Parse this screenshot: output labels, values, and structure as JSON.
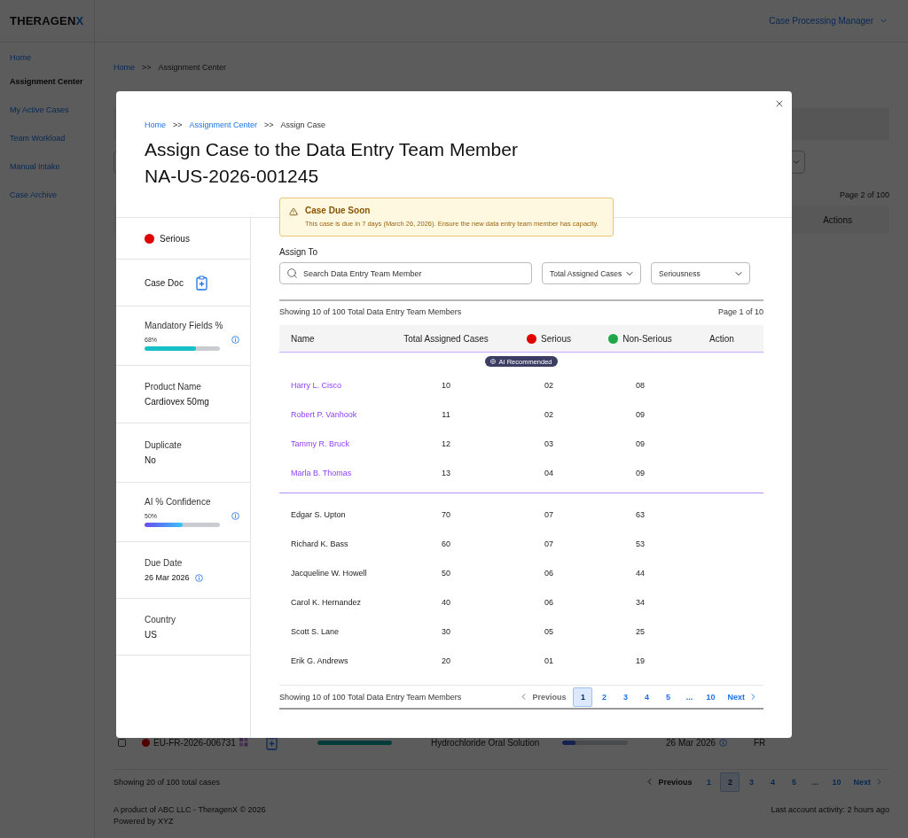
{
  "header": {
    "logo": {
      "text": "THERAGEN",
      "accent": "X"
    },
    "user_menu": "Case Processing Manager"
  },
  "sidebar": {
    "items": [
      {
        "label": "Home",
        "selected": false
      },
      {
        "label": "Assignment Center",
        "selected": true
      },
      {
        "label": "My Active Cases",
        "selected": false
      },
      {
        "label": "Team Workload",
        "selected": false
      },
      {
        "label": "Manual Intake",
        "selected": false
      },
      {
        "label": "Case Archive",
        "selected": false
      }
    ]
  },
  "page": {
    "breadcrumb": [
      {
        "label": "Home",
        "kind": "link"
      },
      {
        "label": ">>",
        "kind": "separator"
      },
      {
        "label": "Assignment Center",
        "kind": "current"
      }
    ],
    "page_info": "Page 2 of 100",
    "table": {
      "columns": [
        "Actions"
      ],
      "row": {
        "checked": false,
        "kind": "serious",
        "case_id": "EU-FR-2026-006731",
        "mandatory": {
          "level": 1
        },
        "product": "Hydrochloride Oral Solution",
        "confidence": {
          "level": 0.2
        },
        "due_date": "26 Mar 2026",
        "country": "FR"
      }
    },
    "cases_showing": "Showing 20 of 100 total cases",
    "pagination": {
      "previous": {
        "label": "Previous",
        "disabled": true
      },
      "pages": [
        {
          "label": "1",
          "selected": false
        },
        {
          "label": "2",
          "selected": true
        },
        {
          "label": "3",
          "selected": false
        },
        {
          "label": "4",
          "selected": false
        },
        {
          "label": "5",
          "selected": false
        },
        {
          "label": "...",
          "selected": false
        },
        {
          "label": "10",
          "selected": false
        }
      ],
      "next": {
        "label": "Next",
        "disabled": false
      }
    },
    "footer": {
      "lines": [
        "A product of ABC LLC - TheragenX © 2026",
        "Powered by XYZ"
      ],
      "last_activity": "Last account activity: 2 hours ago"
    }
  },
  "modal": {
    "breadcrumb": [
      {
        "label": "Home",
        "kind": "link"
      },
      {
        "label": ">>",
        "kind": "separator"
      },
      {
        "label": "Assignment Center",
        "kind": "link"
      },
      {
        "label": ">>",
        "kind": "separator"
      },
      {
        "label": "Assign Case",
        "kind": "current"
      }
    ],
    "title": "Assign Case to the Data Entry Team Member",
    "case_id": "NA-US-2026-001245",
    "alert": {
      "title": "Case Due Soon",
      "message": "This case is due in 7 days (March 26, 2026). Ensure the new data entry team member has capacity."
    },
    "details": [
      {
        "kind": "seriousness",
        "label": "Serious",
        "color": "#e00000"
      },
      {
        "kind": "doc",
        "label": "Case Doc"
      },
      {
        "kind": "meter",
        "label": "Mandatory Fields %",
        "reading": "68%",
        "level": 0.68
      },
      {
        "kind": "text",
        "label": "Product Name",
        "value": "Cardiovex 50mg"
      },
      {
        "kind": "text",
        "label": "Duplicate",
        "value": "No"
      },
      {
        "kind": "gradient",
        "label": "AI % Confidence",
        "reading": "50%",
        "level": 0.5
      },
      {
        "kind": "date",
        "label": "Due Date",
        "value": "26 Mar 2026"
      },
      {
        "kind": "text",
        "label": "Country",
        "value": "US"
      }
    ],
    "assign_label": "Assign To",
    "search": {
      "placeholder": "Search Data Entry Team Member"
    },
    "filters": [
      {
        "value": "Total Assigned Cases"
      },
      {
        "value": "Seriousness"
      }
    ],
    "showing": "Showing 10 of 100 Total Data Entry Team Members",
    "page_info": "Page 1 of 10",
    "columns": [
      {
        "label": "Name"
      },
      {
        "label": "Total Assigned Cases"
      },
      {
        "label": "Serious",
        "color": "#e00000"
      },
      {
        "label": "Non-Serious",
        "color": "#1ea84a"
      },
      {
        "label": "Action"
      }
    ],
    "recommended_badge": "AI Recommended",
    "recommended": [
      {
        "name": "Harry L. Cisco",
        "total": "10",
        "serious": "02",
        "non_serious": "08"
      },
      {
        "name": "Robert P. Vanhook",
        "total": "11",
        "serious": "02",
        "non_serious": "09"
      },
      {
        "name": "Tammy R. Bruck",
        "total": "12",
        "serious": "03",
        "non_serious": "09"
      },
      {
        "name": "Marla B. Thomas",
        "total": "13",
        "serious": "04",
        "non_serious": "09"
      }
    ],
    "members": [
      {
        "name": "Edgar S. Upton",
        "total": "70",
        "serious": "07",
        "non_serious": "63"
      },
      {
        "name": "Richard K. Bass",
        "total": "60",
        "serious": "07",
        "non_serious": "53"
      },
      {
        "name": "Jacqueline W. Howell",
        "total": "50",
        "serious": "06",
        "non_serious": "44"
      },
      {
        "name": "Carol K. Hernandez",
        "total": "40",
        "serious": "06",
        "non_serious": "34"
      },
      {
        "name": "Scott S. Lane",
        "total": "30",
        "serious": "05",
        "non_serious": "25"
      },
      {
        "name": "Erik G. Andrews",
        "total": "20",
        "serious": "01",
        "non_serious": "19"
      }
    ],
    "footer_showing": "Showing 10 of 100 Total Data Entry Team Members",
    "pagination": {
      "previous": {
        "label": "Previous",
        "disabled": true
      },
      "pages": [
        {
          "label": "1",
          "selected": true
        },
        {
          "label": "2",
          "selected": false
        },
        {
          "label": "3",
          "selected": false
        },
        {
          "label": "4",
          "selected": false
        },
        {
          "label": "5",
          "selected": false
        },
        {
          "label": "...",
          "selected": false
        },
        {
          "label": "10",
          "selected": false
        }
      ],
      "next": {
        "label": "Next",
        "disabled": false
      }
    }
  }
}
